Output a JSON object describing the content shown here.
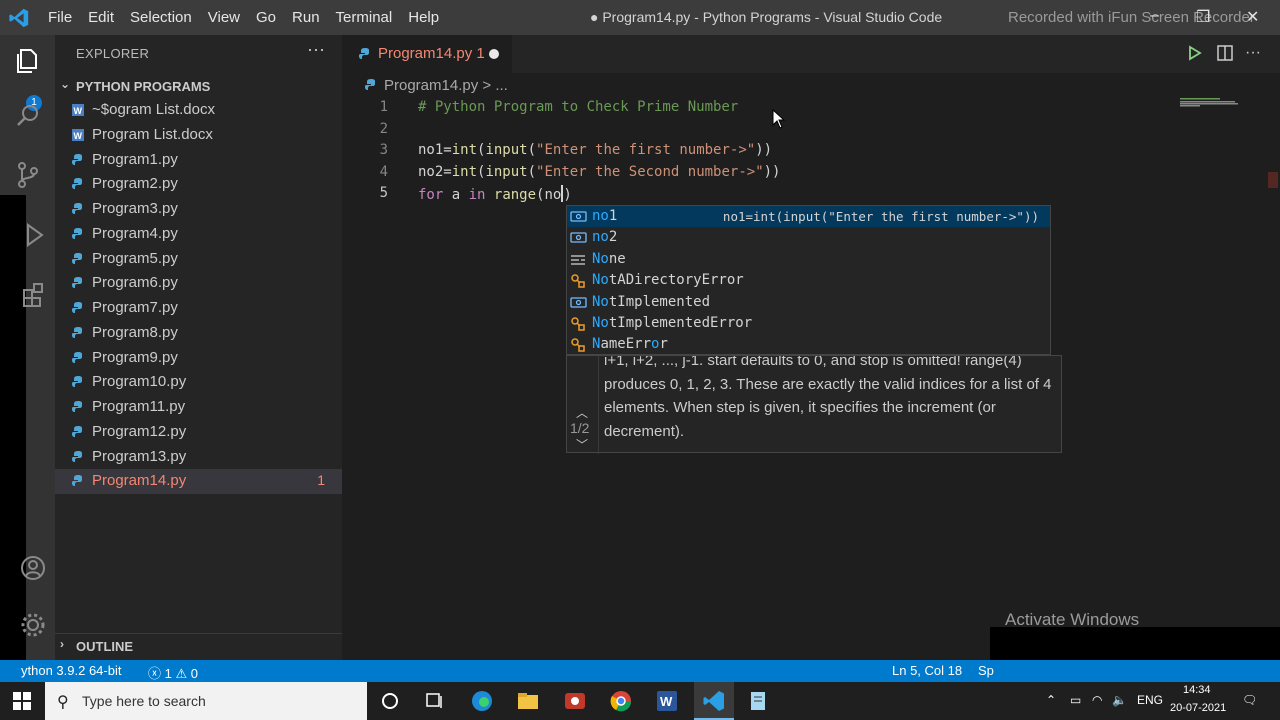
{
  "titlebar": {
    "menu": [
      "File",
      "Edit",
      "Selection",
      "View",
      "Go",
      "Run",
      "Terminal",
      "Help"
    ],
    "title": "● Program14.py - Python Programs - Visual Studio Code",
    "recorded": "Recorded with iFun Screen Recorder",
    "controls": [
      "–",
      "❐",
      "✕"
    ]
  },
  "activity": {
    "explorer_badge": "1"
  },
  "sidebar": {
    "header": "EXPLORER",
    "more": "···",
    "section": "PYTHON PROGRAMS",
    "files": [
      {
        "name": "~$ogram List.docx",
        "type": "docx"
      },
      {
        "name": "Program List.docx",
        "type": "docx"
      },
      {
        "name": "Program1.py",
        "type": "py"
      },
      {
        "name": "Program2.py",
        "type": "py"
      },
      {
        "name": "Program3.py",
        "type": "py"
      },
      {
        "name": "Program4.py",
        "type": "py"
      },
      {
        "name": "Program5.py",
        "type": "py"
      },
      {
        "name": "Program6.py",
        "type": "py"
      },
      {
        "name": "Program7.py",
        "type": "py"
      },
      {
        "name": "Program8.py",
        "type": "py"
      },
      {
        "name": "Program9.py",
        "type": "py"
      },
      {
        "name": "Program10.py",
        "type": "py"
      },
      {
        "name": "Program11.py",
        "type": "py"
      },
      {
        "name": "Program12.py",
        "type": "py"
      },
      {
        "name": "Program13.py",
        "type": "py"
      },
      {
        "name": "Program14.py",
        "type": "py",
        "badge": "1",
        "active": true
      }
    ],
    "outline": "OUTLINE"
  },
  "tab": {
    "label": "Program14.py 1"
  },
  "breadcrumb": {
    "file": "Program14.py",
    "rest": "> ..."
  },
  "editor": {
    "line_numbers": [
      "1",
      "2",
      "3",
      "4",
      "5"
    ],
    "lines": {
      "l1": "# Python Program to Check Prime Number",
      "l3_var": "no1=",
      "l3_fn1": "int",
      "l3_p1": "(",
      "l3_fn2": "input",
      "l3_p2": "(",
      "l3_str": "\"Enter the first number->\"",
      "l3_end": "))",
      "l4_var": "no2=",
      "l4_fn1": "int",
      "l4_p1": "(",
      "l4_fn2": "input",
      "l4_p2": "(",
      "l4_str": "\"Enter the Second number->\"",
      "l4_end": "))",
      "l5_kw": "for",
      "l5_mid": " a ",
      "l5_kw2": "in",
      "l5_sp": " ",
      "l5_fn": "range",
      "l5_rest": "(no",
      "l5_close": ")"
    }
  },
  "suggest": {
    "items": [
      {
        "match": "no",
        "rest": "1",
        "icon": "variable",
        "detail": "no1=int(input(\"Enter the first number->\"))",
        "selected": true
      },
      {
        "match": "no",
        "rest": "2",
        "icon": "variable"
      },
      {
        "match": "No",
        "rest": "ne",
        "icon": "keyword"
      },
      {
        "match": "No",
        "rest": "tADirectoryError",
        "icon": "class"
      },
      {
        "match": "No",
        "rest": "tImplemented",
        "icon": "variable"
      },
      {
        "match": "No",
        "rest": "tImplementedError",
        "icon": "class"
      },
      {
        "match": "N",
        "rest": "ameErr",
        "match2": "o",
        "rest2": "r",
        "icon": "class"
      }
    ]
  },
  "docs": {
    "counter": "1/2",
    "text": "i+1, i+2, ..., j-1. start defaults to 0, and stop is omitted! range(4) produces 0, 1, 2, 3. These are exactly the valid indices for a list of 4 elements. When step is given, it specifies the increment (or decrement)."
  },
  "watermark": "Activate Windows",
  "statusbar": {
    "interpreter": "ython 3.9.2 64-bit",
    "errors": "1",
    "warnings": "0",
    "position": "Ln 5, Col 18",
    "spaces": "Sp"
  },
  "taskbar": {
    "search_placeholder": "Type here to search",
    "language": "ENG",
    "time": "14:34",
    "date": "20-07-2021"
  },
  "colors": {
    "accent": "#007acc",
    "error": "#f48771",
    "comment": "#6a9955",
    "string": "#ce9178",
    "function": "#dcdcaa",
    "keyword": "#c586c0",
    "match": "#2aaaff"
  }
}
